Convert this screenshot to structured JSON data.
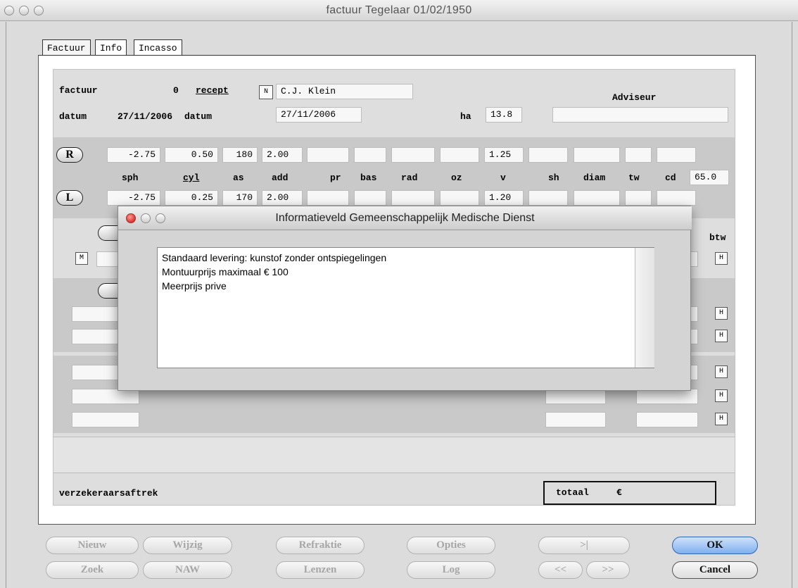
{
  "window": {
    "title": "factuur   Tegelaar 01/02/1950"
  },
  "tabs": [
    "Factuur",
    "Info",
    "Incasso"
  ],
  "header": {
    "factuur_label": "factuur",
    "factuur_value": "0",
    "recept_label": "recept",
    "n_button": "N",
    "recept_name": "C.J. Klein",
    "adviseur_label": "Adviseur",
    "adviseur_value": "",
    "datum_label": "datum",
    "datum_value": "27/11/2006",
    "datum2_label": "datum",
    "datum2_value": "27/11/2006",
    "ha_label": "ha",
    "ha_value": "13.8"
  },
  "refraction": {
    "right_button": "R",
    "left_button": "L",
    "columns": [
      "sph",
      "cyl",
      "as",
      "add",
      "pr",
      "bas",
      "rad",
      "oz",
      "v",
      "sh",
      "diam",
      "tw",
      "cd"
    ],
    "cd_value": "65.0",
    "right": {
      "sph": "-2.75",
      "cyl": "0.50",
      "as": "180",
      "add": "2.00",
      "v": "1.25"
    },
    "left": {
      "sph": "-2.75",
      "cyl": "0.25",
      "as": "170",
      "add": "2.00",
      "v": "1.20"
    }
  },
  "lines": {
    "btw_label": "btw",
    "m_button": "M",
    "h_button": "H"
  },
  "footer": {
    "verzekeraar_label": "verzekeraarsaftrek",
    "totaal_label": "totaal",
    "currency": "€"
  },
  "buttons": {
    "nieuw": "Nieuw",
    "wijzig": "Wijzig",
    "refraktie": "Refraktie",
    "opties": "Opties",
    "last": ">|",
    "ok": "OK",
    "zoek": "Zoek",
    "naw": "NAW",
    "lenzen": "Lenzen",
    "log": "Log",
    "prev": "<<",
    "next": ">>",
    "cancel": "Cancel"
  },
  "modal": {
    "title": "Informatieveld Gemeenschappelijk Medische Dienst",
    "lines": [
      "Standaard levering: kunstof zonder ontspiegelingen",
      "Montuurprijs maximaal € 100",
      "Meerprijs prive"
    ]
  },
  "colors": {
    "ok_button": "#7fb0ee",
    "close_red": "#e0413a"
  }
}
